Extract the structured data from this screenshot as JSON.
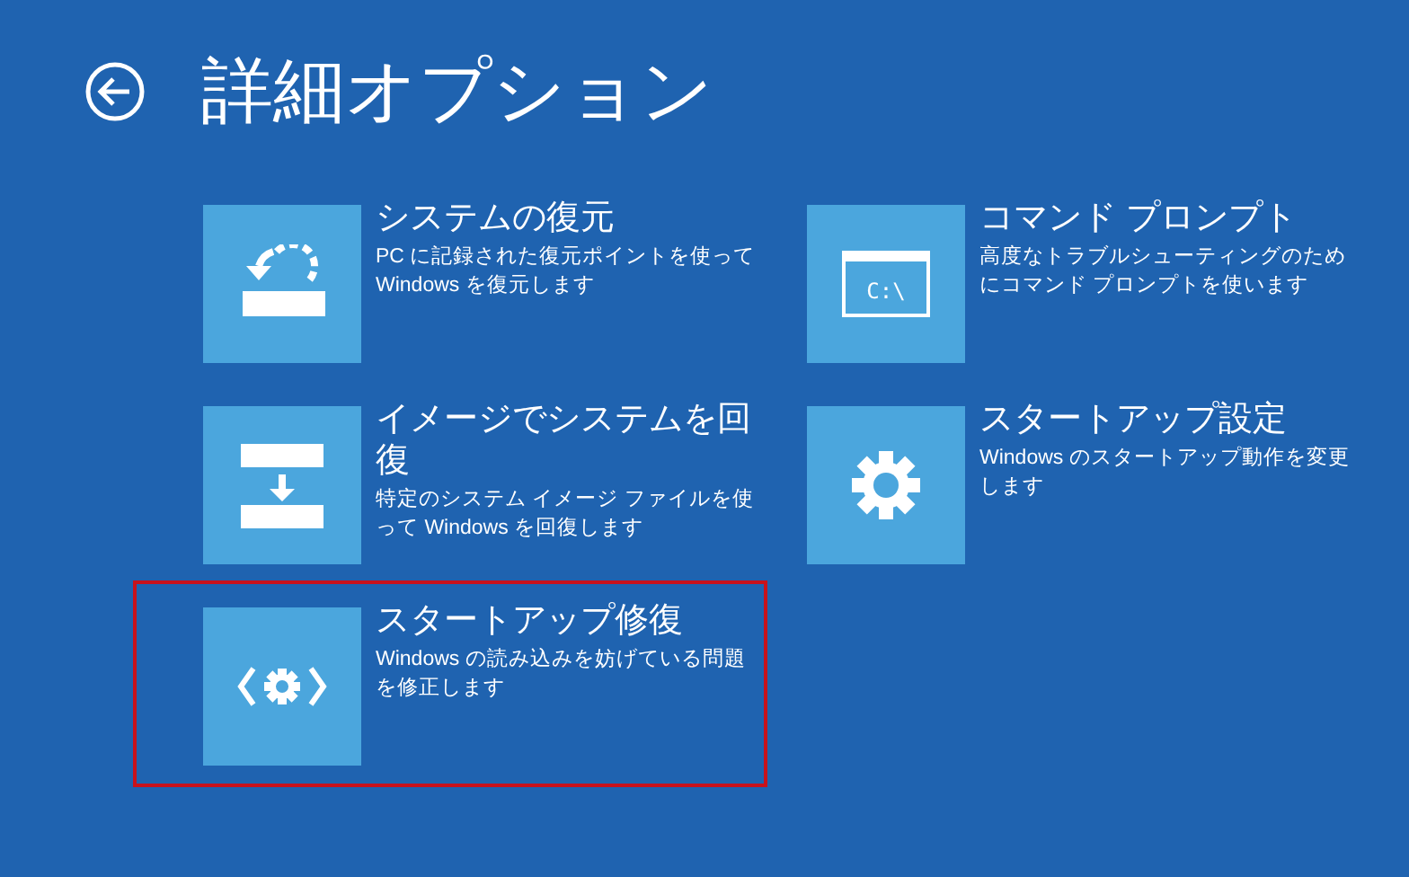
{
  "header": {
    "title": "詳細オプション"
  },
  "options": [
    {
      "kind": "restore",
      "title": "システムの復元",
      "description": "PC に記録された復元ポイントを使って Windows を復元します",
      "highlighted": false
    },
    {
      "kind": "command",
      "title": "コマンド プロンプト",
      "description": "高度なトラブルシューティングのためにコマンド プロンプトを使います",
      "highlighted": false,
      "icon_text": "C:\\"
    },
    {
      "kind": "image",
      "title": "イメージでシステムを回復",
      "description": "特定のシステム イメージ ファイルを使って Windows を回復します",
      "highlighted": false
    },
    {
      "kind": "settings",
      "title": "スタートアップ設定",
      "description": "Windows のスタートアップ動作を変更します",
      "highlighted": false
    },
    {
      "kind": "repair",
      "title": "スタートアップ修復",
      "description": "Windows の読み込みを妨げている問題を修正します",
      "highlighted": true
    }
  ]
}
